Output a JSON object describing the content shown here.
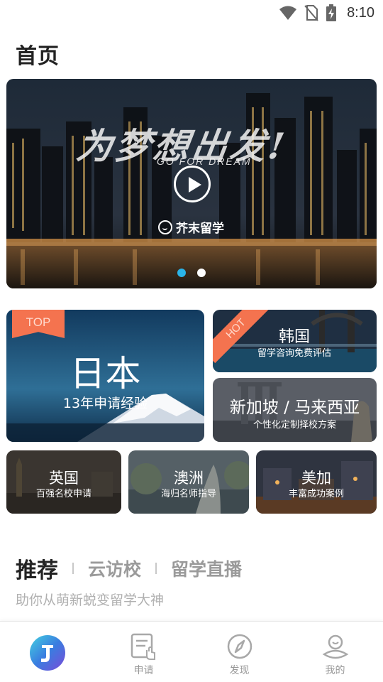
{
  "status_bar": {
    "time": "8:10",
    "icons": [
      "wifi-icon",
      "no-sim-icon",
      "battery-charging-icon"
    ]
  },
  "header": {
    "title": "首页"
  },
  "banner": {
    "headline": "为梦想出发!",
    "subtitle": "GO FOR DREAM",
    "logo_text": "芥末留学",
    "icon": "play-icon",
    "slide_count": 2,
    "active_slide": 1
  },
  "cards": {
    "japan": {
      "tag": "TOP",
      "title": "日本",
      "subtitle": "13年申请经验"
    },
    "korea": {
      "tag": "HOT",
      "title": "韩国",
      "subtitle": "留学咨询免费评估"
    },
    "singapore": {
      "title": "新加坡 / 马来西亚",
      "subtitle": "个性化定制择校方案"
    },
    "uk": {
      "title": "英国",
      "subtitle": "百强名校申请"
    },
    "australia": {
      "title": "澳洲",
      "subtitle": "海归名师指导"
    },
    "usa": {
      "title": "美加",
      "subtitle": "丰富成功案例"
    }
  },
  "recommend": {
    "tabs": [
      "推荐",
      "云访校",
      "留学直播"
    ],
    "active_tab": 0,
    "description": "助你从萌新蜕变留学大神"
  },
  "bottom_nav": {
    "items": [
      {
        "label": "",
        "icon": "app-logo-icon"
      },
      {
        "label": "申请",
        "icon": "apply-form-icon"
      },
      {
        "label": "发现",
        "icon": "compass-icon"
      },
      {
        "label": "我的",
        "icon": "profile-icon"
      }
    ],
    "active": 0
  },
  "colors": {
    "accent": "#2ab4e8",
    "tag": "#f4734f"
  }
}
